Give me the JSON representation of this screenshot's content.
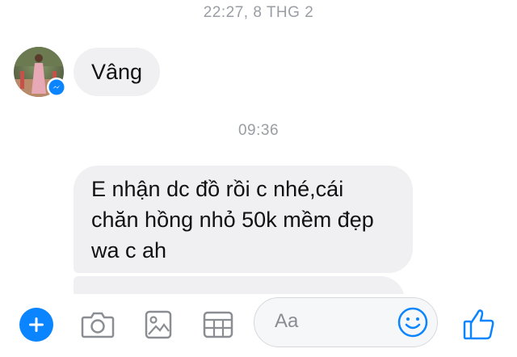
{
  "timestamps": [
    "22:27, 8 THG 2",
    "09:36"
  ],
  "messages": [
    {
      "text": "Vâng"
    },
    {
      "lines": [
        "E nhận dc đồ rồi c nhé,cái",
        "chăn hồng nhỏ 50k mềm đẹp",
        "wa c ah"
      ]
    }
  ],
  "composer": {
    "placeholder": "Aa",
    "icons": [
      "plus-icon",
      "camera-icon",
      "photo-icon",
      "gif-icon",
      "emoji-icon",
      "thumbs-up-icon"
    ]
  },
  "colors": {
    "accent": "#0a84ff",
    "bubble": "#f0f0f2",
    "timestamp": "#9a9da3"
  }
}
